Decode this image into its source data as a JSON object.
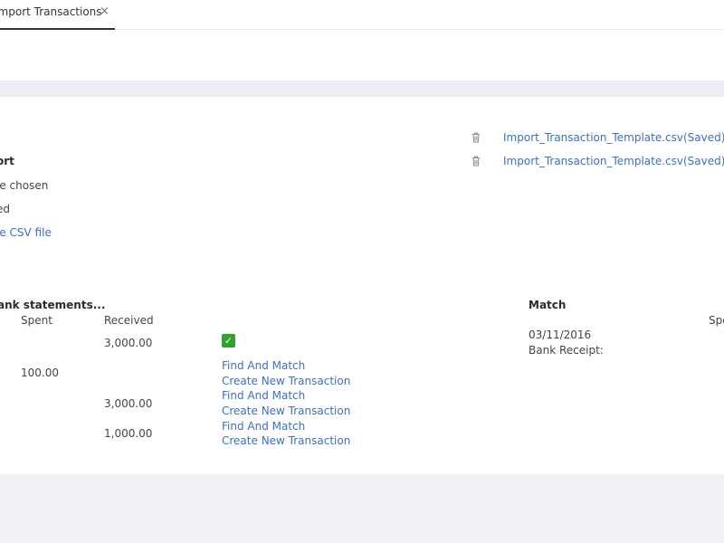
{
  "tab": {
    "label": "Import Transactions",
    "close": "×"
  },
  "import": {
    "heading": "ort",
    "file_chosen": "le chosen",
    "status": "ed",
    "sample_link": "le CSV file"
  },
  "saved_files": [
    {
      "name": "Import_Transaction_Template.csv(Saved)"
    },
    {
      "name": "Import_Transaction_Template.csv(Saved)"
    }
  ],
  "statements": {
    "heading": "ank statements...",
    "columns": {
      "spent": "Spent",
      "received": "Received"
    },
    "rows": [
      {
        "spent": "",
        "received": "3,000.00",
        "action1": "",
        "action2": ""
      },
      {
        "spent": "100.00",
        "received": "",
        "action1": "Find And Match",
        "action2": "Create New Transaction"
      },
      {
        "spent": "",
        "received": "3,000.00",
        "action1": "Find And Match",
        "action2": "Create New Transaction"
      },
      {
        "spent": "",
        "received": "1,000.00",
        "action1": "Find And Match",
        "action2": "Create New Transaction"
      }
    ]
  },
  "match": {
    "heading": "Match",
    "date": "03/11/2016",
    "type": "Bank Receipt:",
    "spent_col": "Spe"
  },
  "colors": {
    "link": "#3d6fc5",
    "check": "#2ea32e",
    "background": "#f0f1f5"
  }
}
